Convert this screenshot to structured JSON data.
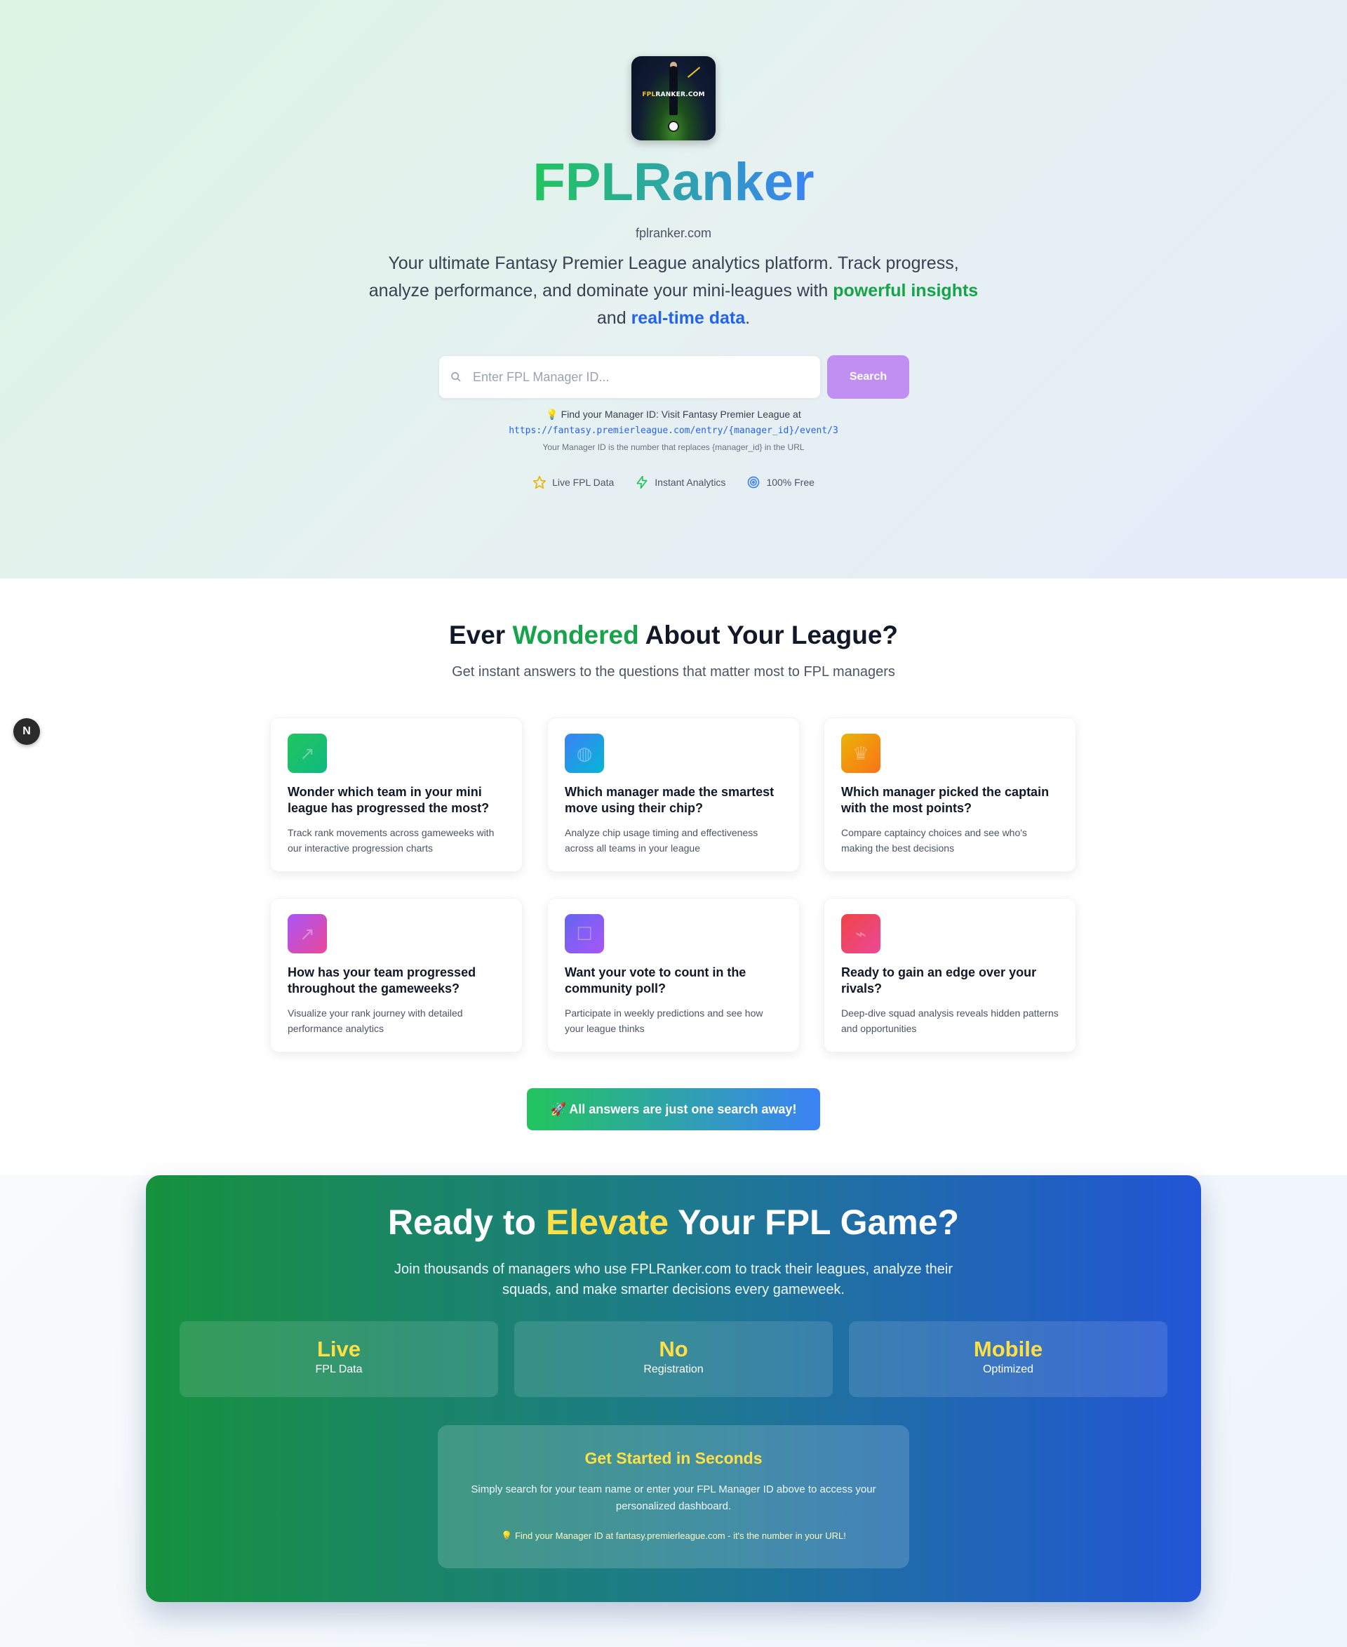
{
  "hero": {
    "logo_text_a": "FPL",
    "logo_text_b": "RANKER.COM",
    "brand": "FPLRanker",
    "domain": "fplranker.com",
    "tagline_prefix": "Your ultimate Fantasy Premier League analytics platform. Track progress, analyze performance, and dominate your mini-leagues with ",
    "tagline_highlight1": "powerful insights",
    "tagline_middle": " and ",
    "tagline_highlight2": "real-time data",
    "tagline_suffix": ".",
    "search_placeholder": "Enter FPL Manager ID...",
    "search_button": "Search",
    "hint_line1": "💡 Find your Manager ID: Visit Fantasy Premier League at",
    "hint_url": "https://fantasy.premierleague.com/entry/{manager_id}/event/3",
    "hint_line3": "Your Manager ID is the number that replaces {manager_id} in the URL",
    "badges": [
      {
        "icon": "star-icon",
        "label": "Live FPL Data",
        "color": "#eab308"
      },
      {
        "icon": "lightning-icon",
        "label": "Instant Analytics",
        "color": "#22c55e"
      },
      {
        "icon": "target-icon",
        "label": "100% Free",
        "color": "#3b82f6"
      }
    ]
  },
  "next_badge": "N",
  "questions": {
    "title_a": "Ever ",
    "title_highlight": "Wondered",
    "title_b": " About Your League?",
    "subtitle": "Get instant answers to the questions that matter most to FPL managers",
    "cards": [
      {
        "title": "Wonder which team in your mini league has progressed the most?",
        "desc": "Track rank movements across gameweeks with our interactive progression charts",
        "icon": "trending-up-icon",
        "gradient": "linear-gradient(135deg,#22c55e,#10b981)"
      },
      {
        "title": "Which manager made the smartest move using their chip?",
        "desc": "Analyze chip usage timing and effectiveness across all teams in your league",
        "icon": "brain-icon",
        "gradient": "linear-gradient(135deg,#3b82f6,#06b6d4)"
      },
      {
        "title": "Which manager picked the captain with the most points?",
        "desc": "Compare captaincy choices and see who's making the best decisions",
        "icon": "crown-icon",
        "gradient": "linear-gradient(135deg,#eab308,#f97316)"
      },
      {
        "title": "How has your team progressed throughout the gameweeks?",
        "desc": "Visualize your rank journey with detailed performance analytics",
        "icon": "chart-icon",
        "gradient": "linear-gradient(135deg,#a855f7,#ec4899)"
      },
      {
        "title": "Want your vote to count in the community poll?",
        "desc": "Participate in weekly predictions and see how your league thinks",
        "icon": "vote-icon",
        "gradient": "linear-gradient(135deg,#6366f1,#a855f7)"
      },
      {
        "title": "Ready to gain an edge over your rivals?",
        "desc": "Deep-dive squad analysis reveals hidden patterns and opportunities",
        "icon": "zap-icon",
        "gradient": "linear-gradient(135deg,#ef4444,#ec4899)"
      }
    ],
    "cta": "🚀 All answers are just one search away!"
  },
  "cta_block": {
    "title_a": "Ready to ",
    "title_highlight": "Elevate",
    "title_b": " Your FPL Game?",
    "subtitle": "Join thousands of managers who use FPLRanker.com to track their leagues, analyze their squads, and make smarter decisions every gameweek.",
    "stats": [
      {
        "value": "Live",
        "label": "FPL Data"
      },
      {
        "value": "No",
        "label": "Registration"
      },
      {
        "value": "Mobile",
        "label": "Optimized"
      }
    ],
    "get_started_title": "Get Started in Seconds",
    "get_started_desc": "Simply search for your team name or enter your FPL Manager ID above to access your personalized dashboard.",
    "get_started_hint": "💡 Find your Manager ID at fantasy.premierleague.com - it's the number in your URL!"
  }
}
